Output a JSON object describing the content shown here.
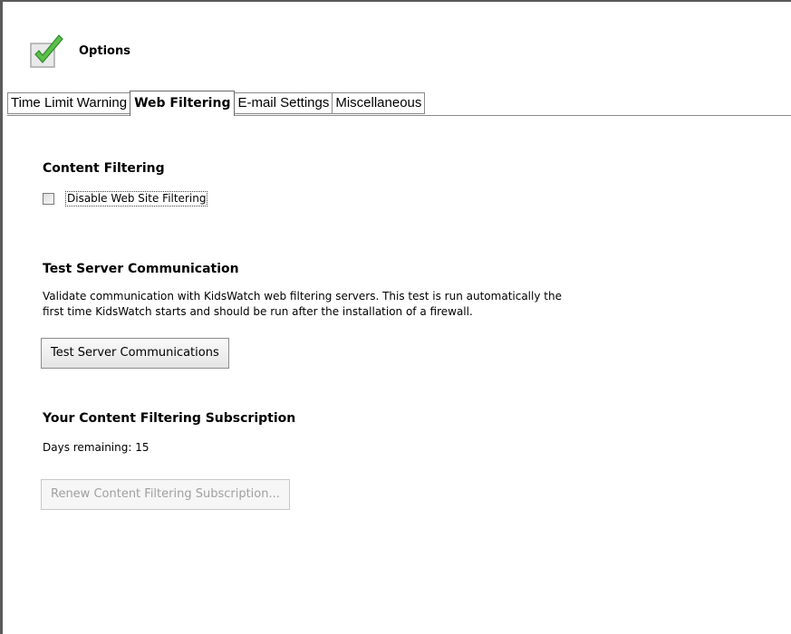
{
  "header": {
    "title": "Options",
    "icon": "checkmark-icon",
    "icon_color": "#4caf50"
  },
  "tabs": [
    {
      "label": "Time Limit Warning",
      "active": false
    },
    {
      "label": "Web Filtering",
      "active": true
    },
    {
      "label": "E-mail Settings",
      "active": false
    },
    {
      "label": "Miscellaneous",
      "active": false
    }
  ],
  "content_filtering": {
    "heading": "Content Filtering",
    "checkbox_label": "Disable Web Site Filtering",
    "checked": false
  },
  "test_server": {
    "heading": "Test Server Communication",
    "description_line1": "Validate communication with KidsWatch web filtering servers. This test is run automatically the",
    "description_line2": "first time KidsWatch starts and should be run after the installation of a firewall.",
    "button_label": "Test Server Communications"
  },
  "subscription": {
    "heading": "Your Content Filtering Subscription",
    "days_remaining": "Days remaining: 15",
    "renew_button_label": "Renew Content Filtering Subscription...",
    "renew_enabled": false
  }
}
